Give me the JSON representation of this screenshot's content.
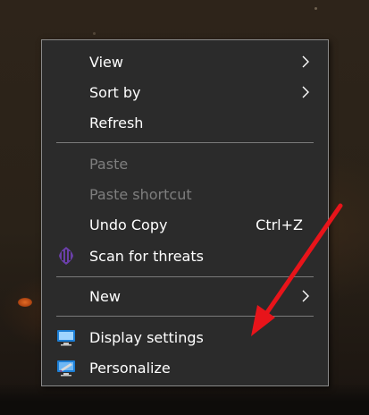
{
  "context_menu": {
    "items": [
      {
        "label": "View",
        "has_submenu": true,
        "disabled": false
      },
      {
        "label": "Sort by",
        "has_submenu": true,
        "disabled": false
      },
      {
        "label": "Refresh",
        "disabled": false
      },
      {
        "label": "Paste",
        "disabled": true
      },
      {
        "label": "Paste shortcut",
        "disabled": true
      },
      {
        "label": "Undo Copy",
        "shortcut": "Ctrl+Z",
        "disabled": false
      },
      {
        "label": "Scan for threats",
        "icon": "antivirus-scan-icon",
        "disabled": false
      },
      {
        "label": "New",
        "has_submenu": true,
        "disabled": false
      },
      {
        "label": "Display settings",
        "icon": "display-settings-icon",
        "disabled": false
      },
      {
        "label": "Personalize",
        "icon": "personalize-icon",
        "disabled": false
      }
    ]
  },
  "colors": {
    "menu_background": "#2b2b2b",
    "menu_text": "#ffffff",
    "disabled_text": "#7e7e7e",
    "separator": "#7a7a7a",
    "annotation_arrow": "#e8141a"
  }
}
